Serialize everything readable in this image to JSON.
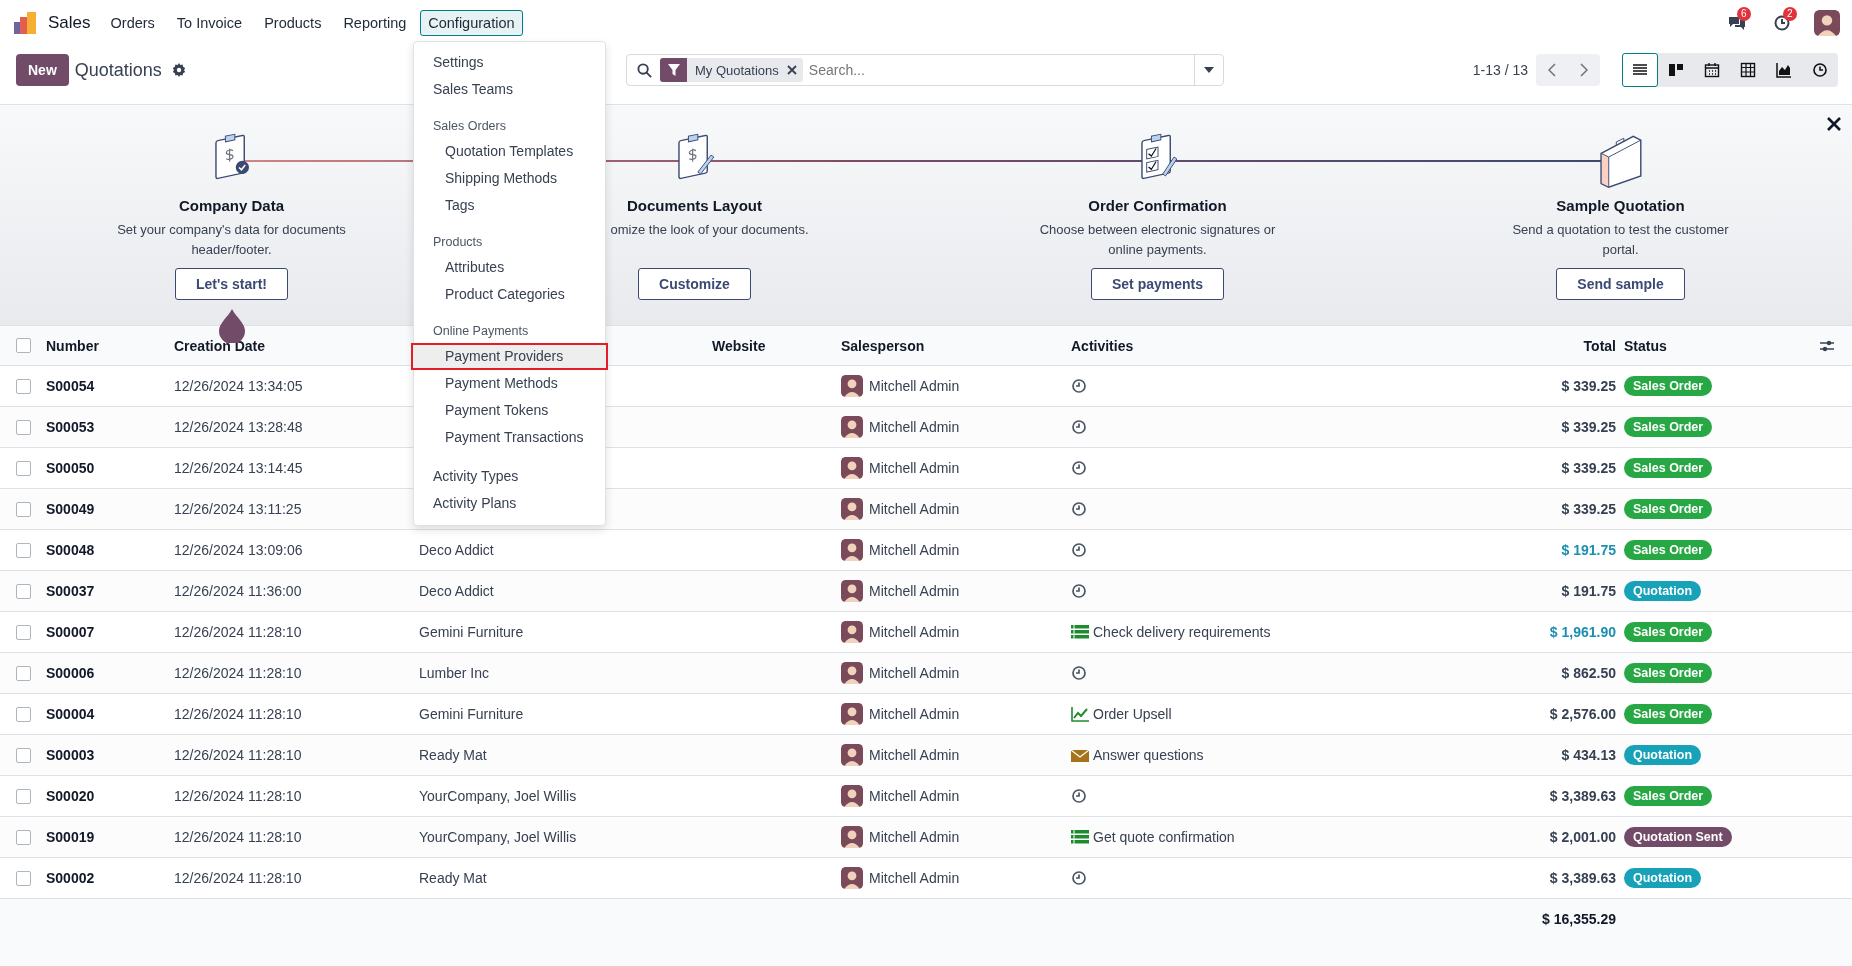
{
  "app": {
    "name": "Sales"
  },
  "menu": [
    {
      "label": "Orders",
      "selected": false
    },
    {
      "label": "To Invoice",
      "selected": false
    },
    {
      "label": "Products",
      "selected": false
    },
    {
      "label": "Reporting",
      "selected": false
    },
    {
      "label": "Configuration",
      "selected": true
    }
  ],
  "notifications": {
    "messages": "6",
    "activities": "2"
  },
  "control_panel": {
    "new_button": "New",
    "title": "Quotations"
  },
  "search": {
    "facet": "My Quotations",
    "placeholder": "Search..."
  },
  "pager": "1-13 / 13",
  "views": [
    {
      "kind": "list",
      "selected": true
    },
    {
      "kind": "kanban",
      "selected": false
    },
    {
      "kind": "calendar",
      "selected": false
    },
    {
      "kind": "pivot",
      "selected": false
    },
    {
      "kind": "graph",
      "selected": false
    },
    {
      "kind": "activity",
      "selected": false
    }
  ],
  "onboarding": {
    "steps": [
      {
        "kind": "invoice-check",
        "title": "Company Data",
        "description": "Set your company's data for documents header/footer.",
        "button": "Let's start!",
        "current": true
      },
      {
        "kind": "invoice-pen",
        "title": "Documents Layout",
        "description": "omize the look of your documents.",
        "button": "Customize",
        "current": false
      },
      {
        "kind": "checklist",
        "title": "Order Confirmation",
        "description": "Choose between electronic signatures or online payments.",
        "button": "Set payments",
        "current": false
      },
      {
        "kind": "case",
        "title": "Sample Quotation",
        "description": "Send a quotation to test the customer portal.",
        "button": "Send sample",
        "current": false
      }
    ]
  },
  "config_menu": [
    {
      "kind": "item",
      "label": "Settings",
      "selected": false
    },
    {
      "kind": "item",
      "label": "Sales Teams",
      "selected": false
    },
    {
      "kind": "header",
      "label": "Sales Orders"
    },
    {
      "kind": "subitem",
      "label": "Quotation Templates",
      "selected": false
    },
    {
      "kind": "subitem",
      "label": "Shipping Methods",
      "selected": false
    },
    {
      "kind": "subitem",
      "label": "Tags",
      "selected": false
    },
    {
      "kind": "header",
      "label": "Products"
    },
    {
      "kind": "subitem",
      "label": "Attributes",
      "selected": false
    },
    {
      "kind": "subitem",
      "label": "Product Categories",
      "selected": false
    },
    {
      "kind": "header",
      "label": "Online Payments"
    },
    {
      "kind": "subitem",
      "label": "Payment Providers",
      "selected": true
    },
    {
      "kind": "subitem",
      "label": "Payment Methods",
      "selected": false
    },
    {
      "kind": "subitem",
      "label": "Payment Tokens",
      "selected": false
    },
    {
      "kind": "subitem",
      "label": "Payment Transactions",
      "selected": false
    },
    {
      "kind": "item",
      "label": "Activity Types",
      "selected": false
    },
    {
      "kind": "item",
      "label": "Activity Plans",
      "selected": false
    }
  ],
  "table": {
    "all_selected": false,
    "columns": {
      "number": "Number",
      "creation_date": "Creation Date",
      "website": "Website",
      "salesperson": "Salesperson",
      "activities": "Activities",
      "total": "Total",
      "status": "Status"
    },
    "rows": [
      {
        "selected": false,
        "number": "S00054",
        "created": "12/26/2024 13:34:05",
        "salesperson": "Mitchell Admin",
        "activity": {
          "kind": "none"
        },
        "total": "$ 339.25",
        "total_highlighted": false,
        "status": "Sales Order",
        "color": "#28a745"
      },
      {
        "selected": false,
        "number": "S00053",
        "created": "12/26/2024 13:28:48",
        "salesperson": "Mitchell Admin",
        "activity": {
          "kind": "none"
        },
        "total": "$ 339.25",
        "total_highlighted": false,
        "status": "Sales Order",
        "color": "#28a745"
      },
      {
        "selected": false,
        "number": "S00050",
        "created": "12/26/2024 13:14:45",
        "salesperson": "Mitchell Admin",
        "activity": {
          "kind": "none"
        },
        "total": "$ 339.25",
        "total_highlighted": false,
        "status": "Sales Order",
        "color": "#28a745"
      },
      {
        "selected": false,
        "number": "S00049",
        "created": "12/26/2024 13:11:25",
        "salesperson": "Mitchell Admin",
        "activity": {
          "kind": "none"
        },
        "total": "$ 339.25",
        "total_highlighted": false,
        "status": "Sales Order",
        "color": "#28a745"
      },
      {
        "selected": false,
        "number": "S00048",
        "created": "12/26/2024 13:09:06",
        "customer": "Deco Addict",
        "salesperson": "Mitchell Admin",
        "activity": {
          "kind": "none"
        },
        "total": "$ 191.75",
        "total_highlighted": true,
        "status": "Sales Order",
        "color": "#28a745"
      },
      {
        "selected": false,
        "number": "S00037",
        "created": "12/26/2024 11:36:00",
        "customer": "Deco Addict",
        "salesperson": "Mitchell Admin",
        "activity": {
          "kind": "none"
        },
        "total": "$ 191.75",
        "total_highlighted": false,
        "status": "Quotation",
        "color": "#17a2b8"
      },
      {
        "selected": false,
        "number": "S00007",
        "created": "12/26/2024 11:28:10",
        "customer": "Gemini Furniture",
        "salesperson": "Mitchell Admin",
        "activity": {
          "kind": "todo",
          "text": "Check delivery requirements"
        },
        "total": "$ 1,961.90",
        "total_highlighted": true,
        "status": "Sales Order",
        "color": "#28a745"
      },
      {
        "selected": false,
        "number": "S00006",
        "created": "12/26/2024 11:28:10",
        "customer": "Lumber Inc",
        "salesperson": "Mitchell Admin",
        "activity": {
          "kind": "none"
        },
        "total": "$ 862.50",
        "total_highlighted": false,
        "status": "Sales Order",
        "color": "#28a745"
      },
      {
        "selected": false,
        "number": "S00004",
        "created": "12/26/2024 11:28:10",
        "customer": "Gemini Furniture",
        "salesperson": "Mitchell Admin",
        "activity": {
          "kind": "upsell",
          "text": "Order Upsell"
        },
        "total": "$ 2,576.00",
        "total_highlighted": false,
        "status": "Sales Order",
        "color": "#28a745"
      },
      {
        "selected": false,
        "number": "S00003",
        "created": "12/26/2024 11:28:10",
        "customer": "Ready Mat",
        "salesperson": "Mitchell Admin",
        "activity": {
          "kind": "email",
          "text": "Answer questions"
        },
        "total": "$ 434.13",
        "total_highlighted": false,
        "status": "Quotation",
        "color": "#17a2b8"
      },
      {
        "selected": false,
        "number": "S00020",
        "created": "12/26/2024 11:28:10",
        "customer": "YourCompany, Joel Willis",
        "salesperson": "Mitchell Admin",
        "activity": {
          "kind": "none"
        },
        "total": "$ 3,389.63",
        "total_highlighted": false,
        "status": "Sales Order",
        "color": "#28a745"
      },
      {
        "selected": false,
        "number": "S00019",
        "created": "12/26/2024 11:28:10",
        "customer": "YourCompany, Joel Willis",
        "salesperson": "Mitchell Admin",
        "activity": {
          "kind": "todo",
          "text": "Get quote confirmation"
        },
        "total": "$ 2,001.00",
        "total_highlighted": false,
        "status": "Quotation Sent",
        "color": "#714b67"
      },
      {
        "selected": false,
        "number": "S00002",
        "created": "12/26/2024 11:28:10",
        "customer": "Ready Mat",
        "salesperson": "Mitchell Admin",
        "activity": {
          "kind": "none"
        },
        "total": "$ 3,389.63",
        "total_highlighted": false,
        "status": "Quotation",
        "color": "#17a2b8"
      }
    ],
    "sum": "$ 16,355.29"
  }
}
